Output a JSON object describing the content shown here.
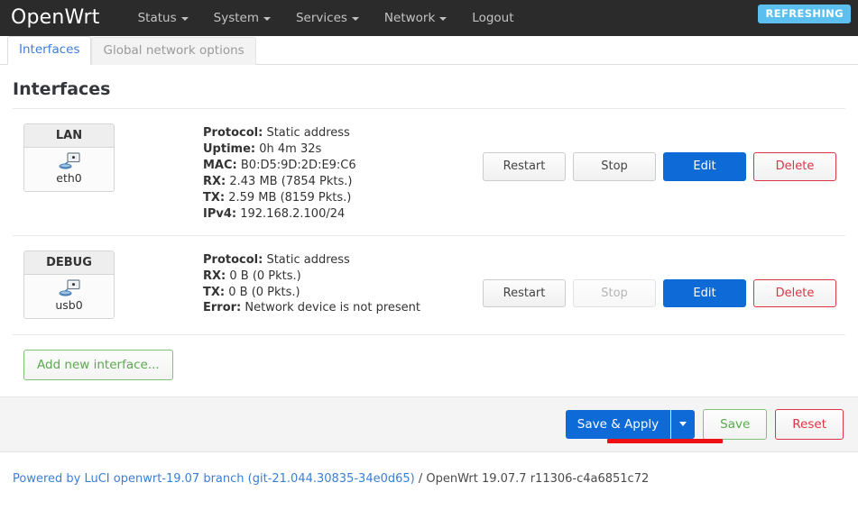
{
  "navbar": {
    "brand": "OpenWrt",
    "items": [
      {
        "label": "Status",
        "has_caret": true
      },
      {
        "label": "System",
        "has_caret": true
      },
      {
        "label": "Services",
        "has_caret": true
      },
      {
        "label": "Network",
        "has_caret": true
      },
      {
        "label": "Logout",
        "has_caret": false
      }
    ],
    "status_badge": "REFRESHING",
    "status_badge_color": "#5bc0f0"
  },
  "tabs": [
    {
      "label": "Interfaces",
      "active": true
    },
    {
      "label": "Global network options",
      "active": false
    }
  ],
  "page": {
    "title": "Interfaces"
  },
  "interfaces": [
    {
      "name": "LAN",
      "device": "eth0",
      "icon": "ethernet-device-icon",
      "details": [
        {
          "label": "Protocol:",
          "value": "Static address"
        },
        {
          "label": "Uptime:",
          "value": "0h 4m 32s"
        },
        {
          "label": "MAC:",
          "value": "B0:D5:9D:2D:E9:C6"
        },
        {
          "label": "RX:",
          "value": "2.43 MB (7854 Pkts.)"
        },
        {
          "label": "TX:",
          "value": "2.59 MB (8159 Pkts.)"
        },
        {
          "label": "IPv4:",
          "value": "192.168.2.100/24"
        }
      ],
      "actions": [
        {
          "label": "Restart",
          "style": "neutral",
          "disabled": false
        },
        {
          "label": "Stop",
          "style": "neutral",
          "disabled": false
        },
        {
          "label": "Edit",
          "style": "primary",
          "disabled": false
        },
        {
          "label": "Delete",
          "style": "danger",
          "disabled": false
        }
      ]
    },
    {
      "name": "DEBUG",
      "device": "usb0",
      "icon": "ethernet-device-icon",
      "details": [
        {
          "label": "Protocol:",
          "value": "Static address"
        },
        {
          "label": "RX:",
          "value": "0 B (0 Pkts.)"
        },
        {
          "label": "TX:",
          "value": "0 B (0 Pkts.)"
        },
        {
          "label": "Error:",
          "value": "Network device is not present"
        }
      ],
      "actions": [
        {
          "label": "Restart",
          "style": "neutral",
          "disabled": false
        },
        {
          "label": "Stop",
          "style": "neutral",
          "disabled": true
        },
        {
          "label": "Edit",
          "style": "primary",
          "disabled": false
        },
        {
          "label": "Delete",
          "style": "danger",
          "disabled": false
        }
      ]
    }
  ],
  "add_interface_label": "Add new interface...",
  "actionbar": {
    "save_apply_label": "Save & Apply",
    "save_label": "Save",
    "reset_label": "Reset",
    "marker_color": "#ee1111"
  },
  "footer": {
    "link_text": "Powered by LuCI openwrt-19.07 branch (git-21.044.30835-34e0d65)",
    "rest_text": " / OpenWrt 19.07.7 r11306-c4a6851c72"
  }
}
